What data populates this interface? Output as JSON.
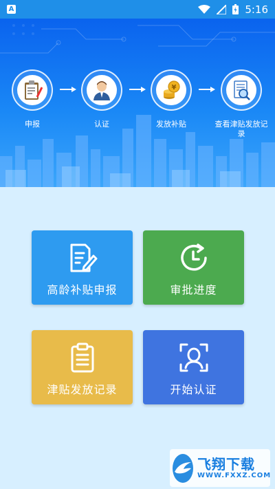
{
  "status_bar": {
    "app_badge": "A",
    "time": "5:16",
    "icons": [
      "wifi-icon",
      "signal-icon",
      "battery-icon"
    ]
  },
  "banner": {
    "steps": [
      {
        "label": "申报",
        "icon": "form-icon"
      },
      {
        "label": "认证",
        "icon": "person-icon"
      },
      {
        "label": "发放补贴",
        "icon": "coins-icon"
      },
      {
        "label": "查看津贴发放记录",
        "icon": "document-search-icon"
      }
    ]
  },
  "tiles": [
    {
      "label": "高龄补贴申报",
      "icon": "edit-form-icon",
      "color": "#2e9bf0"
    },
    {
      "label": "审批进度",
      "icon": "clock-refresh-icon",
      "color": "#4caa4f"
    },
    {
      "label": "津贴发放记录",
      "icon": "clipboard-icon",
      "color": "#e8bb4a"
    },
    {
      "label": "开始认证",
      "icon": "face-scan-icon",
      "color": "#3f74e0"
    }
  ],
  "watermark": {
    "main": "飞翔下载",
    "sub": "WWW.FXXZ.COM"
  }
}
